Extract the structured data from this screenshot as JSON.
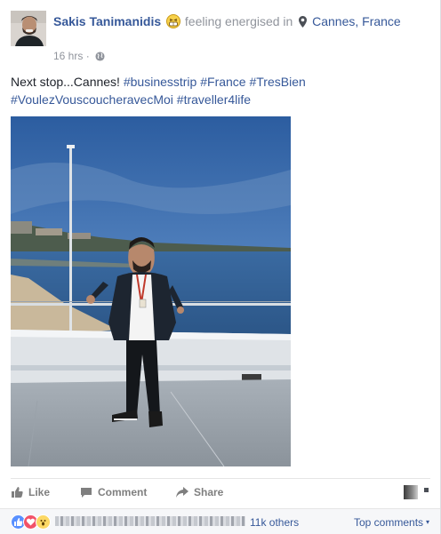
{
  "post": {
    "author": "Sakis Tanimanidis",
    "activity": "feeling energised in",
    "feeling_icon": "grinning-energised-emoji",
    "place": "Cannes, France",
    "place_icon": "map-pin-icon",
    "timestamp": "16 hrs",
    "separator": "·",
    "privacy_icon": "globe-icon",
    "text_intro": "Next stop...Cannes!",
    "hashtags": [
      "#businesstrip",
      "#France",
      "#TresBien",
      "#VoulezVouscoucheravecMoi",
      "#traveller4life"
    ]
  },
  "actions": {
    "like": "Like",
    "comment": "Comment",
    "share": "Share"
  },
  "reactions": {
    "icons": [
      "like-reaction-icon",
      "love-reaction-icon",
      "wow-reaction-icon"
    ],
    "others": "11k others",
    "top_comments": "Top comments",
    "top_comments_caret": "▾"
  },
  "colors": {
    "link": "#365899",
    "muted": "#90949c",
    "like": "#5890ff",
    "love": "#f25268",
    "wow": "#fcd864"
  }
}
